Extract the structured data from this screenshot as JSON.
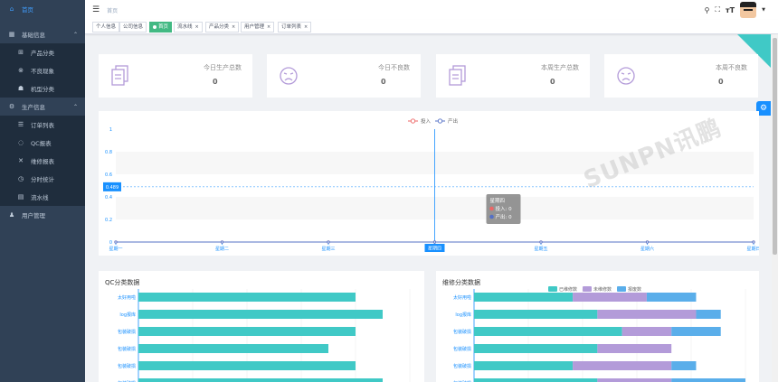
{
  "sidebar": {
    "home": "首页",
    "basic": "基础信息",
    "basic_items": [
      "产品分类",
      "不良现象",
      "机型分类"
    ],
    "production": "生产信息",
    "production_items": [
      "订单列表",
      "QC报表",
      "维修报表",
      "分时统计",
      "流水线"
    ],
    "users": "用户管理"
  },
  "header": {
    "breadcrumb": "首页"
  },
  "tags": [
    {
      "label": "个人信息",
      "closable": false,
      "active": false
    },
    {
      "label": "公司信息",
      "closable": false,
      "active": false
    },
    {
      "label": "首页",
      "closable": false,
      "active": true
    },
    {
      "label": "流水线",
      "closable": true,
      "active": false
    },
    {
      "label": "产品分类",
      "closable": true,
      "active": false
    },
    {
      "label": "用户管理",
      "closable": true,
      "active": false
    },
    {
      "label": "订单列表",
      "closable": true,
      "active": false
    }
  ],
  "close_glyph": "×",
  "stats": [
    {
      "label": "今日生产总数",
      "value": "0",
      "icon": "document-icon"
    },
    {
      "label": "今日不良数",
      "value": "0",
      "icon": "sad-face-icon"
    },
    {
      "label": "本周生产总数",
      "value": "0",
      "icon": "document-icon"
    },
    {
      "label": "本周不良数",
      "value": "0",
      "icon": "sad-face-icon"
    }
  ],
  "watermark": "SUNPN讯鹏",
  "colors": {
    "input": "#ee6666",
    "output": "#5470c6",
    "teal": "#40c9c6",
    "blue": "#1890ff",
    "green": "#42b983",
    "purple": "#b39bd9",
    "sky": "#5aaeea"
  },
  "line_chart": {
    "type": "line",
    "legend": [
      "投入",
      "产出"
    ],
    "categories": [
      "星期一",
      "星期二",
      "星期三",
      "星期四",
      "星期五",
      "星期六",
      "星期日"
    ],
    "series": [
      {
        "name": "投入",
        "values": [
          0,
          0,
          0,
          0,
          0,
          0,
          0
        ]
      },
      {
        "name": "产出",
        "values": [
          0,
          0,
          0,
          0,
          0,
          0,
          0
        ]
      }
    ],
    "ylim": [
      0,
      1
    ],
    "yticks": [
      "0",
      "0.2",
      "0.4",
      "0.6",
      "0.8",
      "1"
    ],
    "pointer_value": "0.489",
    "highlight_category": "星期四",
    "tooltip": {
      "title": "星期四",
      "rows": [
        "投入: 0",
        "产出: 0"
      ]
    }
  },
  "qc_chart": {
    "type": "bar",
    "title": "QC分类数据",
    "categories": [
      "太好用啦",
      "log报库",
      "包装破损",
      "包装破损",
      "包装破损",
      "包装破损"
    ],
    "values": [
      80,
      90,
      80,
      70,
      80,
      90
    ],
    "xmax": 100
  },
  "repair_chart": {
    "type": "bar",
    "title": "维修分类数据",
    "legend": [
      "已维修数",
      "未维修数",
      "报废数"
    ],
    "categories": [
      "太好用啦",
      "log报库",
      "包装破损",
      "包装破损",
      "包装破损",
      "包装破损"
    ],
    "series": [
      {
        "name": "已维修数",
        "values": [
          40,
          50,
          60,
          50,
          40,
          50
        ]
      },
      {
        "name": "未维修数",
        "values": [
          30,
          40,
          20,
          30,
          40,
          30
        ]
      },
      {
        "name": "报废数",
        "values": [
          20,
          10,
          20,
          0,
          10,
          30
        ]
      }
    ],
    "xmax": 110
  }
}
